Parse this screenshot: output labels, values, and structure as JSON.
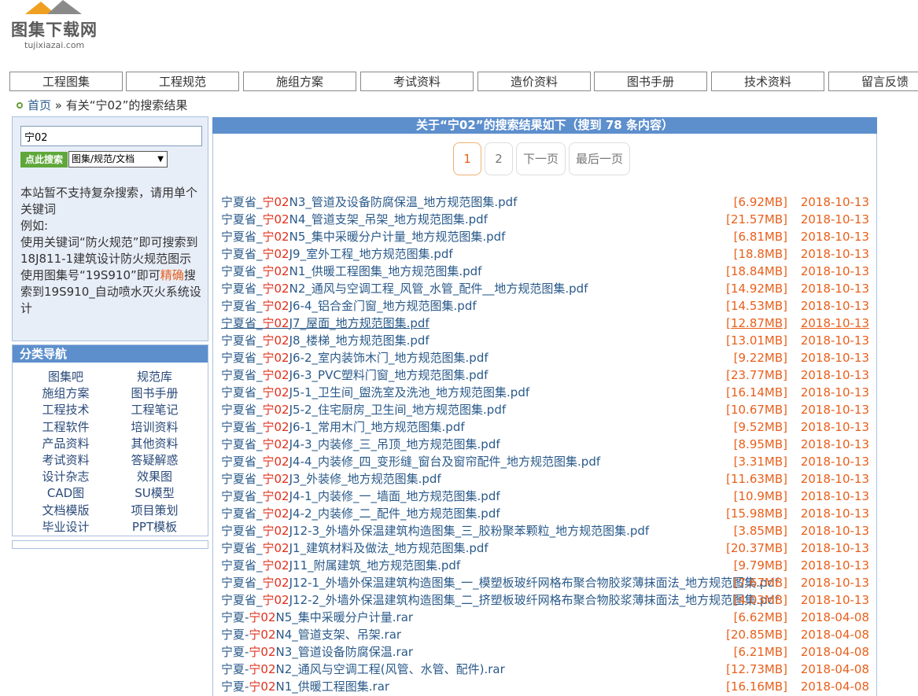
{
  "logo": {
    "title": "图集下载网",
    "subtitle": "tujixiazai.com"
  },
  "nav": [
    "工程图集",
    "工程规范",
    "施组方案",
    "考试资料",
    "造价资料",
    "图书手册",
    "技术资料",
    "留言反馈"
  ],
  "breadcrumb": {
    "home": "首页",
    "sep": " » ",
    "current": "有关“宁02”的搜索结果"
  },
  "search": {
    "value": "宁02",
    "button": "点此搜索",
    "select": "图集/规范/文档",
    "help": [
      {
        "text": "本站暂不支持复杂搜索，请用单个关键词"
      },
      {
        "text": "例如:"
      },
      {
        "text": "使用关键词“防火规范”即可搜索到18J811-1建筑设计防火规范图示"
      },
      {
        "pre": "使用图集号“19S910”即可",
        "hl": "精确",
        "post": "搜索到19S910_自动喷水灭火系统设计"
      }
    ]
  },
  "categories": {
    "title": "分类导航",
    "items": [
      "图集吧",
      "规范库",
      "施组方案",
      "图书手册",
      "工程技术",
      "工程笔记",
      "工程软件",
      "培训资料",
      "产品资料",
      "其他资料",
      "考试资料",
      "答疑解惑",
      "设计杂志",
      "效果图",
      "CAD图",
      "SU模型",
      "文档模版",
      "项目策划",
      "毕业设计",
      "PPT模板"
    ]
  },
  "results": {
    "header": "关于“宁02”的搜索结果如下（搜到 78 条内容）",
    "pager": [
      "1",
      "2",
      "下一页",
      "最后一页"
    ],
    "items": [
      {
        "pre": "宁夏省_",
        "kw": "宁02",
        "post": "N3_管道及设备防腐保温_地方规范图集.pdf",
        "size": "[6.92MB]",
        "date": "2018-10-13"
      },
      {
        "pre": "宁夏省_",
        "kw": "宁02",
        "post": "N4_管道支架_吊架_地方规范图集.pdf",
        "size": "[21.57MB]",
        "date": "2018-10-13"
      },
      {
        "pre": "宁夏省_",
        "kw": "宁02",
        "post": "N5_集中采暖分户计量_地方规范图集.pdf",
        "size": "[6.81MB]",
        "date": "2018-10-13"
      },
      {
        "pre": "宁夏省_",
        "kw": "宁02",
        "post": "J9_室外工程_地方规范图集.pdf",
        "size": "[18.8MB]",
        "date": "2018-10-13"
      },
      {
        "pre": "宁夏省_",
        "kw": "宁02",
        "post": "N1_供暖工程图集_地方规范图集.pdf",
        "size": "[18.84MB]",
        "date": "2018-10-13"
      },
      {
        "pre": "宁夏省_",
        "kw": "宁02",
        "post": "N2_通风与空调工程_风管_水管_配件__地方规范图集.pdf",
        "size": "[14.92MB]",
        "date": "2018-10-13"
      },
      {
        "pre": "宁夏省_",
        "kw": "宁02",
        "post": "J6-4_铝合金门窗_地方规范图集.pdf",
        "size": "[14.53MB]",
        "date": "2018-10-13"
      },
      {
        "pre": "宁夏省_",
        "kw": "宁02",
        "post": "J7_屋面_地方规范图集.pdf",
        "size": "[12.87MB]",
        "date": "2018-10-13"
      },
      {
        "pre": "宁夏省_",
        "kw": "宁02",
        "post": "J8_楼梯_地方规范图集.pdf",
        "size": "[13.01MB]",
        "date": "2018-10-13"
      },
      {
        "pre": "宁夏省_",
        "kw": "宁02",
        "post": "J6-2_室内装饰木门_地方规范图集.pdf",
        "size": "[9.22MB]",
        "date": "2018-10-13"
      },
      {
        "pre": "宁夏省_",
        "kw": "宁02",
        "post": "J6-3_PVC塑料门窗_地方规范图集.pdf",
        "size": "[23.77MB]",
        "date": "2018-10-13"
      },
      {
        "pre": "宁夏省_",
        "kw": "宁02",
        "post": "J5-1_卫生间_盥洗室及洗池_地方规范图集.pdf",
        "size": "[16.14MB]",
        "date": "2018-10-13"
      },
      {
        "pre": "宁夏省_",
        "kw": "宁02",
        "post": "J5-2_住宅厨房_卫生间_地方规范图集.pdf",
        "size": "[10.67MB]",
        "date": "2018-10-13"
      },
      {
        "pre": "宁夏省_",
        "kw": "宁02",
        "post": "J6-1_常用木门_地方规范图集.pdf",
        "size": "[9.52MB]",
        "date": "2018-10-13"
      },
      {
        "pre": "宁夏省_",
        "kw": "宁02",
        "post": "J4-3_内装修_三_吊顶_地方规范图集.pdf",
        "size": "[8.95MB]",
        "date": "2018-10-13"
      },
      {
        "pre": "宁夏省_",
        "kw": "宁02",
        "post": "J4-4_内装修_四_变形缝_窗台及窗帘配件_地方规范图集.pdf",
        "size": "[3.31MB]",
        "date": "2018-10-13"
      },
      {
        "pre": "宁夏省_",
        "kw": "宁02",
        "post": "J3_外装修_地方规范图集.pdf",
        "size": "[11.63MB]",
        "date": "2018-10-13"
      },
      {
        "pre": "宁夏省_",
        "kw": "宁02",
        "post": "J4-1_内装修_一_墙面_地方规范图集.pdf",
        "size": "[10.9MB]",
        "date": "2018-10-13"
      },
      {
        "pre": "宁夏省_",
        "kw": "宁02",
        "post": "J4-2_内装修_二_配件_地方规范图集.pdf",
        "size": "[15.98MB]",
        "date": "2018-10-13"
      },
      {
        "pre": "宁夏省_",
        "kw": "宁02",
        "post": "J12-3_外墙外保温建筑构造图集_三_胶粉聚苯颗粒_地方规范图集.pdf",
        "size": "[3.85MB]",
        "date": "2018-10-13"
      },
      {
        "pre": "宁夏省_",
        "kw": "宁02",
        "post": "J1_建筑材料及做法_地方规范图集.pdf",
        "size": "[20.37MB]",
        "date": "2018-10-13"
      },
      {
        "pre": "宁夏省_",
        "kw": "宁02",
        "post": "J11_附属建筑_地方规范图集.pdf",
        "size": "[9.79MB]",
        "date": "2018-10-13"
      },
      {
        "pre": "宁夏省_",
        "kw": "宁02",
        "post": "J12-1_外墙外保温建筑构造图集_一_模塑板玻纤网格布聚合物胶浆薄抹面法_地方规范图集.pdf",
        "size": "[7.67MB]",
        "date": "2018-10-13"
      },
      {
        "pre": "宁夏省_",
        "kw": "宁02",
        "post": "J12-2_外墙外保温建筑构造图集_二_挤塑板玻纤网格布聚合物胶浆薄抹面法_地方规范图集.pdf",
        "size": "[4.03MB]",
        "date": "2018-10-13"
      },
      {
        "pre": "宁夏-",
        "kw": "宁02",
        "post": "N5_集中采暖分户计量.rar",
        "size": "[6.62MB]",
        "date": "2018-04-08"
      },
      {
        "pre": "宁夏-",
        "kw": "宁02",
        "post": "N4_管道支架、吊架.rar",
        "size": "[20.85MB]",
        "date": "2018-04-08"
      },
      {
        "pre": "宁夏-",
        "kw": "宁02",
        "post": "N3_管道设备防腐保温.rar",
        "size": "[6.21MB]",
        "date": "2018-04-08"
      },
      {
        "pre": "宁夏-",
        "kw": "宁02",
        "post": "N2_通风与空调工程(风管、水管、配件).rar",
        "size": "[12.73MB]",
        "date": "2018-04-08"
      },
      {
        "pre": "宁夏-",
        "kw": "宁02",
        "post": "N1_供暖工程图集.rar",
        "size": "[16.16MB]",
        "date": "2018-04-08"
      }
    ]
  },
  "colors": {
    "accent": "#5d8fcd",
    "keyword": "#e0301c",
    "meta": "#e8601c",
    "link": "#2a5a8a",
    "button": "#5fa73a"
  }
}
